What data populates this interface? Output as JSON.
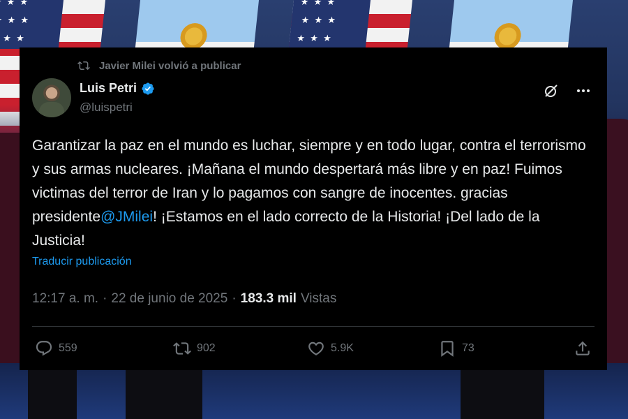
{
  "repost": {
    "icon": "repost-icon",
    "text": "Javier Milei volvió a publicar"
  },
  "author": {
    "name": "Luis Petri",
    "handle": "@luispetri",
    "verified_icon": "verified-badge-icon",
    "verified_color": "#1d9bf0"
  },
  "tweet": {
    "text_before_mention": "Garantizar la paz en el mundo es luchar, siempre y en todo lugar, contra el terrorismo y sus armas nucleares. ¡Mañana el mundo despertará más libre y en paz! Fuimos victimas del terror de Iran y lo pagamos con sangre de inocentes. gracias presidente",
    "mention": "@JMilei",
    "text_after_mention": "! ¡Estamos en el lado correcto de la Historia! ¡Del lado de la Justicia!",
    "translate_label": "Traducir publicación"
  },
  "meta": {
    "time": "12:17 a. m.",
    "separator": "·",
    "date": "22 de junio de 2025",
    "views_count": "183.3 mil",
    "views_label": "Vistas"
  },
  "actions": {
    "replies": "559",
    "reposts": "902",
    "likes": "5.9K",
    "bookmarks": "73"
  },
  "colors": {
    "card_bg": "#000000",
    "text": "#e7e9ea",
    "muted": "#71767b",
    "accent": "#1d9bf0"
  }
}
